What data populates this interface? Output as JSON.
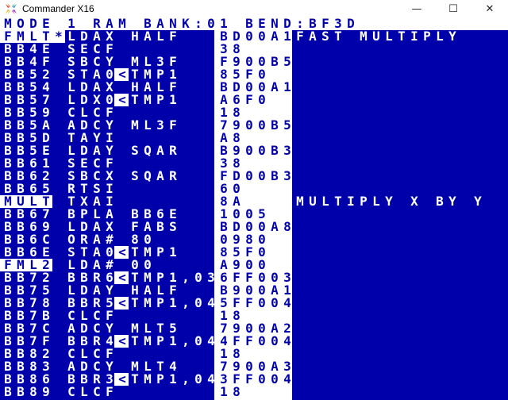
{
  "window": {
    "title": "Commander X16",
    "icon": "commander-x16-logo-icon",
    "controls": {
      "minimize": "—",
      "maximize": "☐",
      "close": "✕"
    }
  },
  "colors": {
    "screen_bg": "#0000aa",
    "text_fg": "#ffffff",
    "hex_column_bg": "#ffffff",
    "hex_column_fg": "#0000aa"
  },
  "status_line": {
    "mode": "MODE 1",
    "ram_bank": "RAM BANK:01",
    "bend": "BEND:BF3D",
    "text": "MODE 1 RAM BANK:01 BEND:BF3D"
  },
  "listing": [
    {
      "label": "FMLT",
      "label_inverse": true,
      "marker": "*",
      "opcode": "LDAX",
      "zp_indirect": false,
      "operand": "HALF",
      "hex": "BD00A1",
      "comment": "FAST MULTIPLY"
    },
    {
      "label": "BB4E",
      "label_inverse": false,
      "marker": "",
      "opcode": "SECF",
      "zp_indirect": false,
      "operand": "",
      "hex": "38",
      "comment": ""
    },
    {
      "label": "BB4F",
      "label_inverse": false,
      "marker": "",
      "opcode": "SBCY",
      "zp_indirect": false,
      "operand": "ML3F",
      "hex": "F900B5",
      "comment": ""
    },
    {
      "label": "BB52",
      "label_inverse": false,
      "marker": "",
      "opcode": "STA0",
      "zp_indirect": true,
      "operand": "TMP1",
      "hex": "85F0",
      "comment": ""
    },
    {
      "label": "BB54",
      "label_inverse": false,
      "marker": "",
      "opcode": "LDAX",
      "zp_indirect": false,
      "operand": "HALF",
      "hex": "BD00A1",
      "comment": ""
    },
    {
      "label": "BB57",
      "label_inverse": false,
      "marker": "",
      "opcode": "LDX0",
      "zp_indirect": true,
      "operand": "TMP1",
      "hex": "A6F0",
      "comment": ""
    },
    {
      "label": "BB59",
      "label_inverse": false,
      "marker": "",
      "opcode": "CLCF",
      "zp_indirect": false,
      "operand": "",
      "hex": "18",
      "comment": ""
    },
    {
      "label": "BB5A",
      "label_inverse": false,
      "marker": "",
      "opcode": "ADCY",
      "zp_indirect": false,
      "operand": "ML3F",
      "hex": "7900B5",
      "comment": ""
    },
    {
      "label": "BB5D",
      "label_inverse": false,
      "marker": "",
      "opcode": "TAYI",
      "zp_indirect": false,
      "operand": "",
      "hex": "A8",
      "comment": ""
    },
    {
      "label": "BB5E",
      "label_inverse": false,
      "marker": "",
      "opcode": "LDAY",
      "zp_indirect": false,
      "operand": "SQAR",
      "hex": "B900B3",
      "comment": ""
    },
    {
      "label": "BB61",
      "label_inverse": false,
      "marker": "",
      "opcode": "SECF",
      "zp_indirect": false,
      "operand": "",
      "hex": "38",
      "comment": ""
    },
    {
      "label": "BB62",
      "label_inverse": false,
      "marker": "",
      "opcode": "SBCX",
      "zp_indirect": false,
      "operand": "SQAR",
      "hex": "FD00B3",
      "comment": ""
    },
    {
      "label": "BB65",
      "label_inverse": false,
      "marker": "",
      "opcode": "RTSI",
      "zp_indirect": false,
      "operand": "",
      "hex": "60",
      "comment": ""
    },
    {
      "label": "MULT",
      "label_inverse": true,
      "marker": "",
      "opcode": "TXAI",
      "zp_indirect": false,
      "operand": "",
      "hex": "8A",
      "comment": "MULTIPLY X BY Y"
    },
    {
      "label": "BB67",
      "label_inverse": false,
      "marker": "",
      "opcode": "BPLA",
      "zp_indirect": false,
      "operand": "BB6E",
      "hex": "1005",
      "comment": ""
    },
    {
      "label": "BB69",
      "label_inverse": false,
      "marker": "",
      "opcode": "LDAX",
      "zp_indirect": false,
      "operand": "FABS",
      "hex": "BD00A8",
      "comment": ""
    },
    {
      "label": "BB6C",
      "label_inverse": false,
      "marker": "",
      "opcode": "ORA#",
      "zp_indirect": false,
      "operand": "80",
      "hex": "0980",
      "comment": ""
    },
    {
      "label": "BB6E",
      "label_inverse": false,
      "marker": "",
      "opcode": "STA0",
      "zp_indirect": true,
      "operand": "TMP1",
      "hex": "85F0",
      "comment": ""
    },
    {
      "label": "FML2",
      "label_inverse": true,
      "marker": "",
      "opcode": "LDA#",
      "zp_indirect": false,
      "operand": "00",
      "hex": "A900",
      "comment": ""
    },
    {
      "label": "BB72",
      "label_inverse": false,
      "marker": "",
      "opcode": "BBR6",
      "zp_indirect": true,
      "operand": "TMP1,03",
      "hex": "6FF003",
      "comment": ""
    },
    {
      "label": "BB75",
      "label_inverse": false,
      "marker": "",
      "opcode": "LDAY",
      "zp_indirect": false,
      "operand": "HALF",
      "hex": "B900A1",
      "comment": ""
    },
    {
      "label": "BB78",
      "label_inverse": false,
      "marker": "",
      "opcode": "BBR5",
      "zp_indirect": true,
      "operand": "TMP1,04",
      "hex": "5FF004",
      "comment": ""
    },
    {
      "label": "BB7B",
      "label_inverse": false,
      "marker": "",
      "opcode": "CLCF",
      "zp_indirect": false,
      "operand": "",
      "hex": "18",
      "comment": ""
    },
    {
      "label": "BB7C",
      "label_inverse": false,
      "marker": "",
      "opcode": "ADCY",
      "zp_indirect": false,
      "operand": "MLT5",
      "hex": "7900A2",
      "comment": ""
    },
    {
      "label": "BB7F",
      "label_inverse": false,
      "marker": "",
      "opcode": "BBR4",
      "zp_indirect": true,
      "operand": "TMP1,04",
      "hex": "4FF004",
      "comment": ""
    },
    {
      "label": "BB82",
      "label_inverse": false,
      "marker": "",
      "opcode": "CLCF",
      "zp_indirect": false,
      "operand": "",
      "hex": "18",
      "comment": ""
    },
    {
      "label": "BB83",
      "label_inverse": false,
      "marker": "",
      "opcode": "ADCY",
      "zp_indirect": false,
      "operand": "MLT4",
      "hex": "7900A3",
      "comment": ""
    },
    {
      "label": "BB86",
      "label_inverse": false,
      "marker": "",
      "opcode": "BBR3",
      "zp_indirect": true,
      "operand": "TMP1,04",
      "hex": "3FF004",
      "comment": ""
    },
    {
      "label": "BB89",
      "label_inverse": false,
      "marker": "",
      "opcode": "CLCF",
      "zp_indirect": false,
      "operand": "",
      "hex": "18",
      "comment": ""
    }
  ],
  "glyphs": {
    "zp_indirect": "<"
  }
}
